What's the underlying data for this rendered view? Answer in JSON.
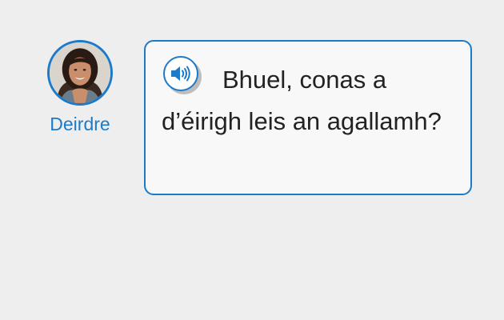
{
  "speaker": {
    "name": "Deirdre",
    "avatar_icon": "profile-photo",
    "name_color": "#1c7ac8"
  },
  "message": {
    "text": "Bhuel, conas a d’éirigh leis an agallamh?",
    "audio_icon": "speaker-volume-icon"
  },
  "colors": {
    "accent": "#1c7ac8",
    "background": "#eeeeee",
    "bubble_background": "#f8f8f8",
    "text": "#222222"
  }
}
